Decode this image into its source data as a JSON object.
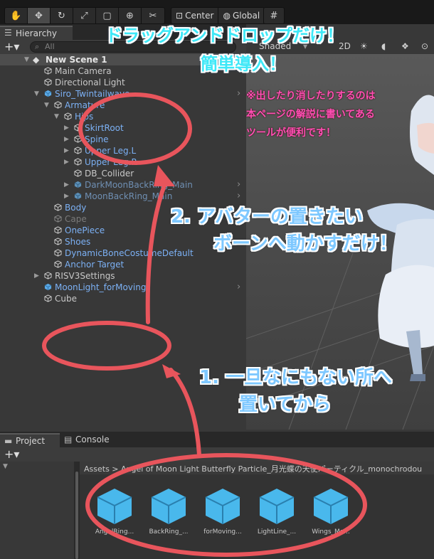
{
  "toolbar": {
    "center_label": "Center",
    "global_label": "Global"
  },
  "hierarchy": {
    "tab_label": "Hierarchy",
    "search_placeholder": "All",
    "rows": [
      {
        "label": "New Scene 1"
      },
      {
        "label": "Main Camera"
      },
      {
        "label": "Directional Light"
      },
      {
        "label": "Siro_Twintailwave"
      },
      {
        "label": "Armature"
      },
      {
        "label": "Hips"
      },
      {
        "label": "SkirtRoot"
      },
      {
        "label": "Spine"
      },
      {
        "label": "Upper Leg.L"
      },
      {
        "label": "Upper Leg.R"
      },
      {
        "label": "DB_Collider"
      },
      {
        "label": "DarkMoonBackRing_Main"
      },
      {
        "label": "MoonBackRing_Main"
      },
      {
        "label": "Body"
      },
      {
        "label": "Cape"
      },
      {
        "label": "OnePiece"
      },
      {
        "label": "Shoes"
      },
      {
        "label": "DynamicBoneCostumeDefault"
      },
      {
        "label": "Anchor Target"
      },
      {
        "label": "RISV3Settings"
      },
      {
        "label": "MoonLight_forMoving"
      },
      {
        "label": "Cube"
      }
    ]
  },
  "scene": {
    "shading_label": "Shaded",
    "mode_label": "2D"
  },
  "project": {
    "tab_label": "Project",
    "console_label": "Console",
    "breadcrumb": "Assets > Angel of Moon Light Butterfly Particle_月光蝶の天使パーティクル_monochrodou",
    "assets": [
      {
        "label": "AngelRing..."
      },
      {
        "label": "BackRing_..."
      },
      {
        "label": "forMoving..."
      },
      {
        "label": "LightLine_..."
      },
      {
        "label": "Wings_Mo..."
      }
    ]
  },
  "annotations": {
    "headline_1": "ドラッグアンドドロップだけ！",
    "headline_2": "簡単導入！",
    "note_1": "※出したり消したりするのは",
    "note_2": "本ページの解説に書いてある",
    "note_3": "ツールが便利です！",
    "step2_1": "2. アバターの置きたい",
    "step2_2": "ボーンへ動かすだけ！",
    "step1_1": "1. 一旦なにもない所へ",
    "step1_2": "置いてから"
  },
  "colors": {
    "annotation_red": "#e8555c",
    "cube_blue": "#49b8ec",
    "link_blue": "#7cb1f5"
  }
}
